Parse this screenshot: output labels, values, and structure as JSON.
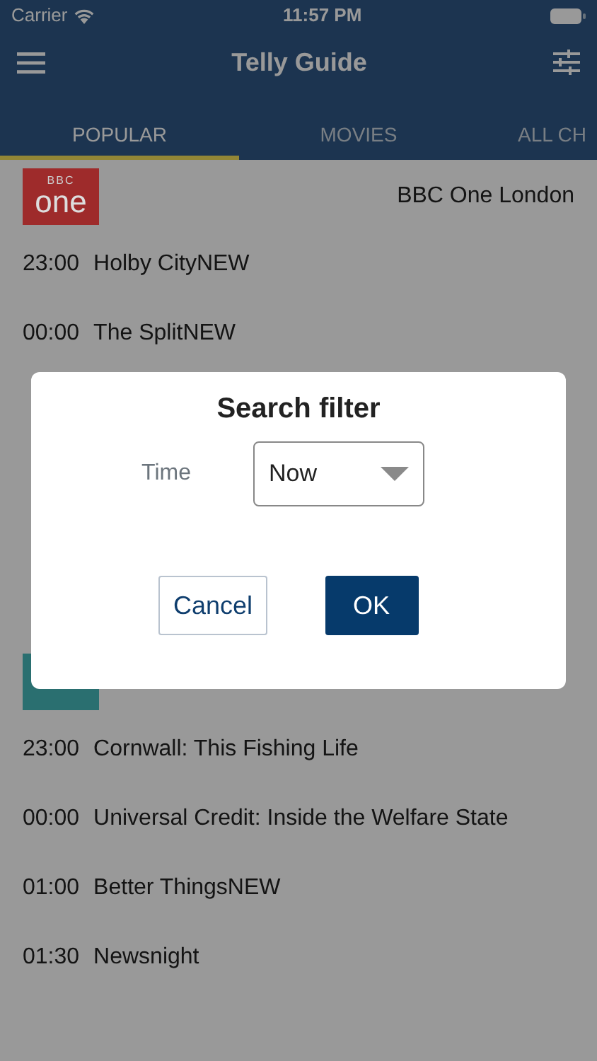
{
  "status_bar": {
    "carrier": "Carrier",
    "time": "11:57 PM"
  },
  "nav": {
    "title": "Telly Guide"
  },
  "tabs": [
    {
      "label": "POPULAR",
      "selected": true
    },
    {
      "label": "MOVIES",
      "selected": false
    },
    {
      "label": "ALL CH",
      "selected": false
    }
  ],
  "channels": [
    {
      "name": "BBC One London",
      "logo": {
        "caption": "BBC",
        "text": "one",
        "color": "#9e2b2b"
      },
      "programmes": [
        {
          "time": "23:00",
          "title": "Holby CityNEW"
        },
        {
          "time": "00:00",
          "title": "The SplitNEW"
        }
      ]
    },
    {
      "logo": {
        "color": "#2a6f70"
      },
      "programmes": [
        {
          "time": "23:00",
          "title": "Cornwall: This Fishing Life"
        },
        {
          "time": "00:00",
          "title": "Universal Credit: Inside the Welfare State"
        },
        {
          "time": "01:00",
          "title": "Better ThingsNEW"
        },
        {
          "time": "01:30",
          "title": "Newsnight"
        }
      ]
    }
  ],
  "dialog": {
    "title": "Search filter",
    "fields": [
      {
        "label": "Time",
        "value": "Now"
      }
    ],
    "buttons": [
      {
        "label": "Cancel",
        "kind": "secondary"
      },
      {
        "label": "OK",
        "kind": "primary"
      }
    ]
  }
}
